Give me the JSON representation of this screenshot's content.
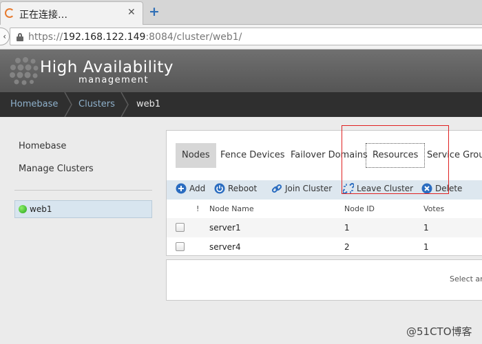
{
  "browser": {
    "tab_title": "正在连接…",
    "tab_close": "✕",
    "new_tab": "+",
    "back": "‹",
    "url_prefix": "https://",
    "url_host": "192.168.122.149",
    "url_rest": ":8084/cluster/web1/"
  },
  "header": {
    "title": "High Availability",
    "subtitle": "management"
  },
  "breadcrumb": {
    "items": [
      "Homebase",
      "Clusters",
      "web1"
    ]
  },
  "sidebar": {
    "links": [
      "Homebase",
      "Manage Clusters"
    ],
    "clusters": [
      {
        "name": "web1",
        "status_color": "#2fb31f"
      }
    ]
  },
  "tabs": [
    "Nodes",
    "Fence Devices",
    "Failover Domains",
    "Resources",
    "Service Groups"
  ],
  "toolbar": {
    "add": "Add",
    "reboot": "Reboot",
    "join": "Join Cluster",
    "leave": "Leave Cluster",
    "delete": "Delete"
  },
  "grid": {
    "headers": [
      "!",
      "Node Name",
      "Node ID",
      "Votes"
    ],
    "rows": [
      {
        "name": "server1",
        "id": "1",
        "votes": "1"
      },
      {
        "name": "server4",
        "id": "2",
        "votes": "1"
      }
    ]
  },
  "detail": {
    "text": "Select an"
  },
  "watermark": "@51CTO博客",
  "colors": {
    "accent": "#2f6fb6",
    "highlight_box": "#e02020",
    "toolbar_bg": "#dde7ef"
  }
}
